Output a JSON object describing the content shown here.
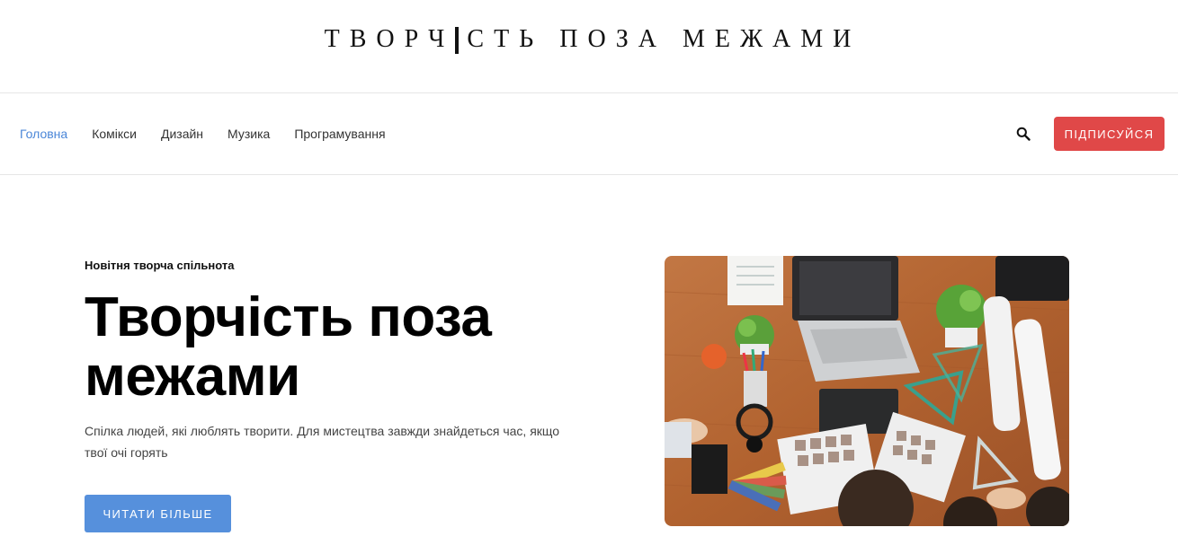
{
  "header": {
    "logo_part1": "ТВОРЧ",
    "logo_part2": "СТЬ ПОЗА МЕЖАМИ"
  },
  "nav": {
    "items": [
      {
        "label": "Головна",
        "active": true
      },
      {
        "label": "Комікси",
        "active": false
      },
      {
        "label": "Дизайн",
        "active": false
      },
      {
        "label": "Музика",
        "active": false
      },
      {
        "label": "Програмування",
        "active": false
      }
    ],
    "search_icon": "search-icon",
    "subscribe_label": "ПІДПИСУЙСЯ"
  },
  "hero": {
    "eyebrow": "Новітня творча спільнота",
    "title": "Творчість поза межами",
    "description": "Спілка людей, які люблять творити. Для мистецтва завжди знайдеться час, якщо твої очі горять",
    "cta_label": "ЧИТАТИ БІЛЬШЕ"
  },
  "colors": {
    "accent_blue": "#5690dc",
    "nav_active": "#4a86d8",
    "subscribe_red": "#e04848",
    "table_wood": "#b5673a"
  }
}
